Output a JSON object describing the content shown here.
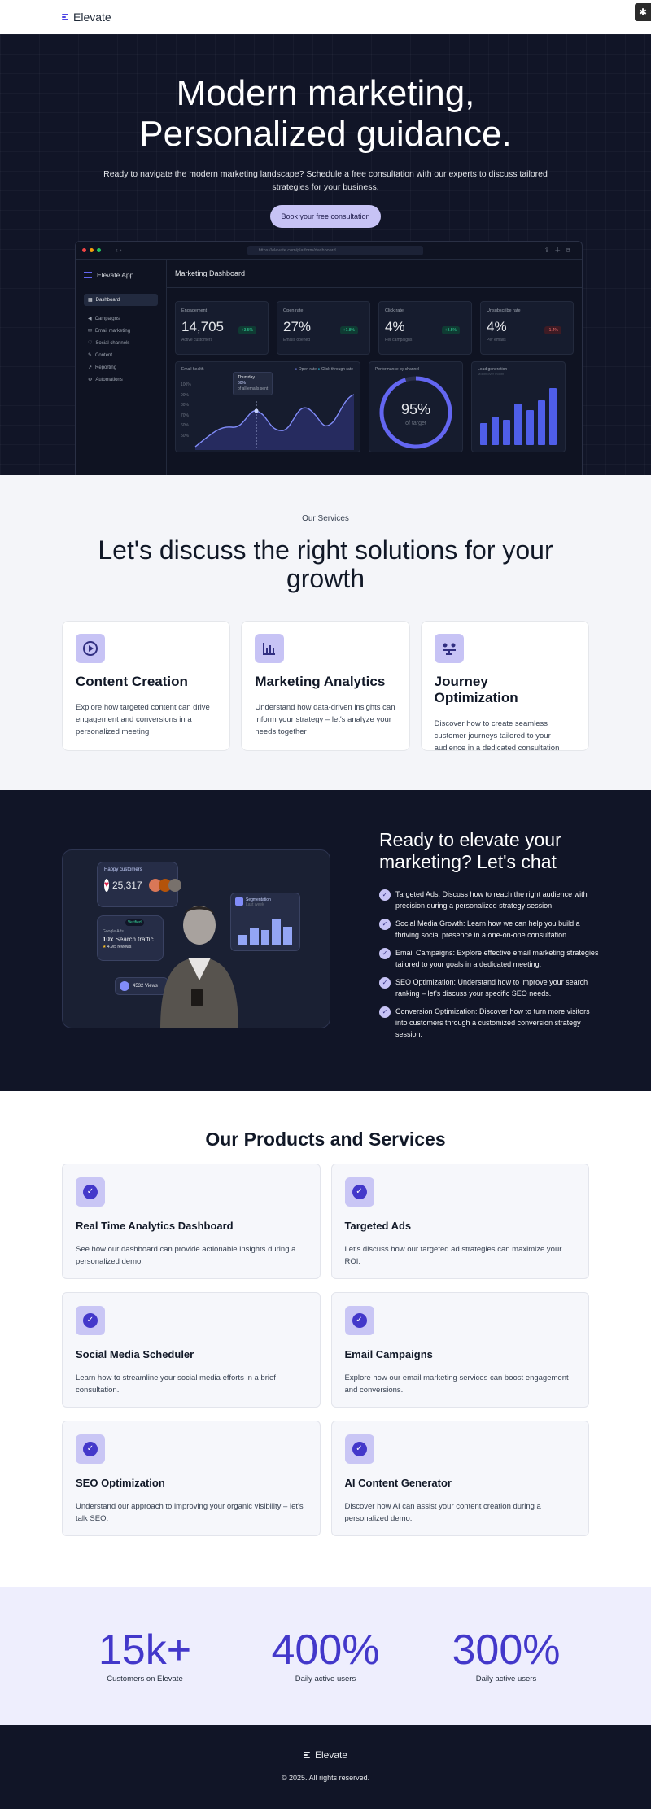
{
  "nav": {
    "brand": "Elevate",
    "corner_icon": "linktree-icon"
  },
  "hero": {
    "title_line1": "Modern marketing,",
    "title_line2": "Personalized guidance.",
    "subtitle": "Ready to navigate the modern marketing landscape? Schedule a free consultation with our experts to discuss tailored strategies for your business.",
    "cta": "Book your free consultation"
  },
  "dashboard": {
    "url": "https://elevate.com/platform/dashboard",
    "app_name": "Elevate App",
    "title": "Marketing Dashboard",
    "sidebar": [
      "Dashboard",
      "Campaigns",
      "Email marketing",
      "Social channels",
      "Content",
      "Reporting",
      "Automations"
    ],
    "kpis": [
      {
        "label": "Engagement",
        "value": "14,705",
        "sub": "Active customers",
        "change": "+3.5%",
        "dir": "up"
      },
      {
        "label": "Open rate",
        "value": "27%",
        "sub": "Emails opened",
        "change": "+1.8%",
        "dir": "up"
      },
      {
        "label": "Click rate",
        "value": "4%",
        "sub": "Per campaigns",
        "change": "+3.5%",
        "dir": "up"
      },
      {
        "label": "Unsubscribe rate",
        "value": "4%",
        "sub": "Per emails",
        "change": "-1.4%",
        "dir": "down"
      }
    ],
    "email_health": {
      "label": "Email health",
      "legend1": "Open rate",
      "legend2": "Click through rate",
      "tooltip_day": "Thursday",
      "tooltip_value": "60%",
      "tooltip_sub": "of all emails sent",
      "yticks": [
        "100%",
        "90%",
        "80%",
        "70%",
        "60%",
        "50%"
      ]
    },
    "performance": {
      "label": "Performance by channel",
      "value": "95%",
      "sub": "of target",
      "progress": 0.95
    },
    "leads": {
      "label": "Lead generation",
      "sub": "Month over month",
      "bars": [
        0.35,
        0.45,
        0.4,
        0.65,
        0.55,
        0.7,
        0.9
      ]
    }
  },
  "services": {
    "eyebrow": "Our Services",
    "heading": "Let's discuss the right solutions for your growth",
    "cards": [
      {
        "icon": "play-circle-icon",
        "title": "Content Creation",
        "text": "Explore how targeted content can drive engagement and conversions in a personalized meeting"
      },
      {
        "icon": "bar-chart-icon",
        "title": "Marketing Analytics",
        "text": "Understand how data-driven insights can inform your strategy – let's analyze your needs together"
      },
      {
        "icon": "route-icon",
        "title": "Journey Optimization",
        "text": "Discover how to create seamless customer journeys tailored to your audience in a dedicated consultation"
      }
    ]
  },
  "chat": {
    "heading": "Ready to elevate your marketing? Let's chat",
    "illustration": {
      "happy_label": "Happy customers",
      "happy_count": "25,317",
      "google_ads": "Google Ads",
      "verified": "Verified",
      "traffic_mult": "10x",
      "traffic_label": "Search traffic",
      "rating": "4.9/5",
      "reviews": "reviews",
      "views": "4532 Views",
      "segment": "Segmentation",
      "segment_sub": "Last week",
      "segment_bars": [
        0.3,
        0.5,
        0.45,
        0.8,
        0.55
      ]
    },
    "items": [
      "Targeted Ads: Discuss how to reach the right audience with precision during a personalized strategy session",
      "Social Media Growth: Learn how we can help you build a thriving social presence in a one-on-one consultation",
      "Email Campaigns: Explore effective email marketing strategies tailored to your goals in a dedicated meeting.",
      "SEO Optimization: Understand how to improve your search ranking – let's discuss your specific SEO needs.",
      "Conversion Optimization: Discover how to turn more visitors into customers through a customized conversion strategy session."
    ]
  },
  "products": {
    "heading": "Our Products and Services",
    "cards": [
      {
        "title": "Real Time Analytics Dashboard",
        "text": "See how our dashboard can provide actionable insights during a personalized demo."
      },
      {
        "title": "Targeted Ads",
        "text": "Let's discuss how our targeted ad strategies can maximize your ROI."
      },
      {
        "title": "Social Media Scheduler",
        "text": "Learn how to streamline your social media efforts in a brief consultation."
      },
      {
        "title": "Email Campaigns",
        "text": "Explore how our email marketing services can boost engagement and conversions."
      },
      {
        "title": "SEO Optimization",
        "text": "Understand our approach to improving your organic visibility – let's talk SEO."
      },
      {
        "title": "AI Content Generator",
        "text": "Discover how AI can assist your content creation during a personalized demo."
      }
    ]
  },
  "stats": [
    {
      "value": "15k+",
      "label": "Customers on Elevate"
    },
    {
      "value": "400%",
      "label": "Daily active users"
    },
    {
      "value": "300%",
      "label": "Daily active users"
    }
  ],
  "footer": {
    "brand": "Elevate",
    "copyright": "© 2025. All rights reserved."
  },
  "colors": {
    "accent": "#4338ca",
    "dark": "#111527",
    "lavender": "#c7c3f5"
  }
}
